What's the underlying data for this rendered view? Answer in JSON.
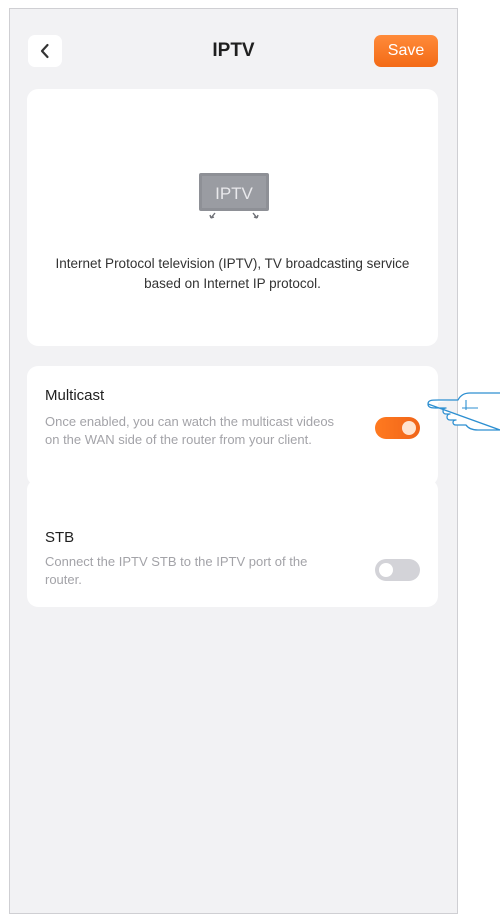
{
  "header": {
    "title": "IPTV",
    "save_label": "Save",
    "back_icon": "chevron-left-icon"
  },
  "intro": {
    "tv_icon_label": "IPTV",
    "description": "Internet Protocol television (IPTV), TV broadcasting service based on Internet IP protocol."
  },
  "settings": [
    {
      "title": "Multicast",
      "description": "Once enabled, you can watch the multicast videos on the WAN side of the router from your client.",
      "enabled": true
    },
    {
      "title": "STB",
      "description": "Connect the IPTV STB to the IPTV port of the router.",
      "enabled": false
    }
  ],
  "colors": {
    "accent": "#f36a16",
    "background": "#f2f2f4",
    "toggle_off": "#d3d3d8"
  }
}
